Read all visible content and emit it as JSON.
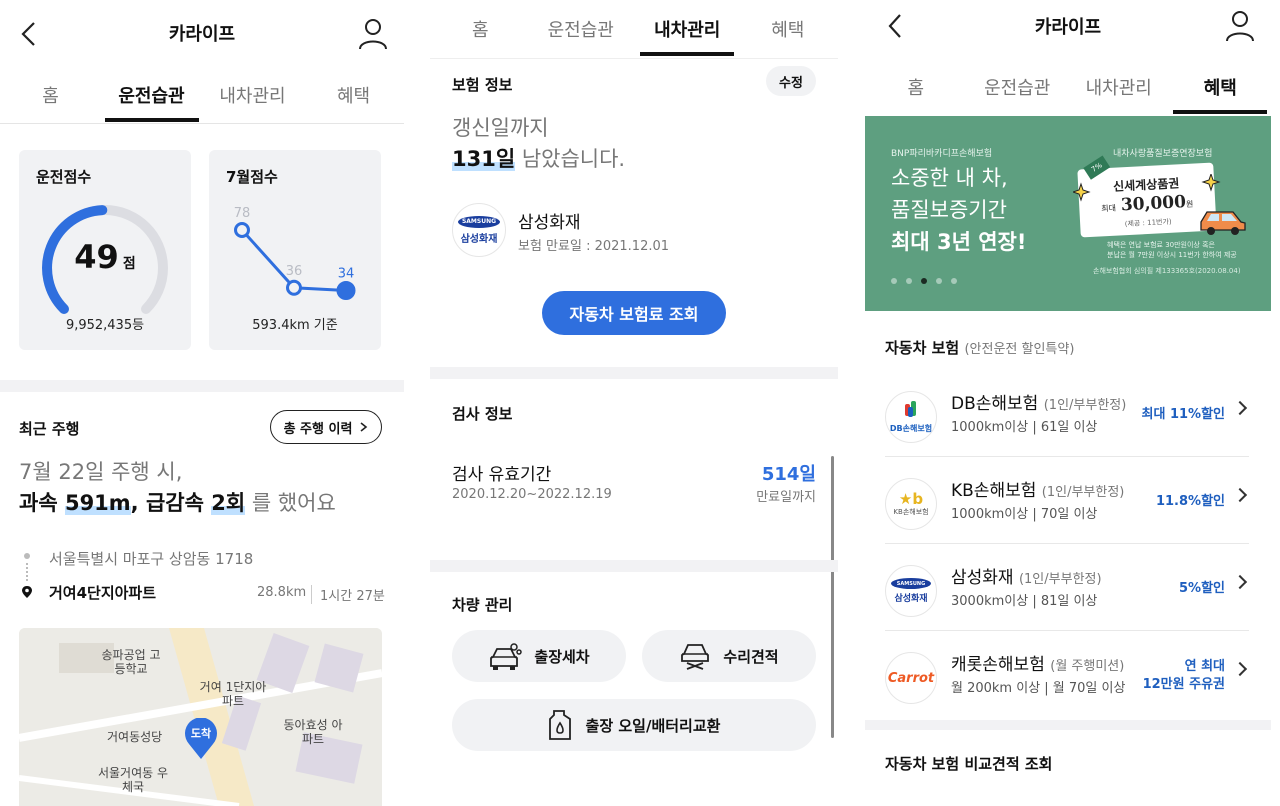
{
  "panel1": {
    "title": "카라이프",
    "tabs": [
      "홈",
      "운전습관",
      "내차관리",
      "혜택"
    ],
    "active_tab": 1,
    "score_card": {
      "label": "운전점수",
      "score": "49",
      "unit": "점",
      "rank": "9,952,435등",
      "gauge_fraction": 0.49
    },
    "month_card": {
      "label": "7월점수",
      "caption": "593.4km 기준",
      "chart_data": {
        "type": "line",
        "values": [
          78,
          36,
          34
        ],
        "ylim": [
          0,
          100
        ]
      },
      "point_labels": [
        "78",
        "36",
        "34"
      ]
    },
    "recent": {
      "title": "최근 주행",
      "history_button": "총 주행 이력",
      "line1": "7월 22일 주행 시,",
      "summary": {
        "p1": "과속 ",
        "p2": "591m",
        "p3": ", 급감속 ",
        "p4": "2회",
        "p5": " 를 했어요"
      },
      "start": "서울특별시 마포구 상암동 1718",
      "end": "거여4단지아파트",
      "distance": "28.8km",
      "duration": "1시간 27분"
    },
    "map": {
      "labels": [
        "송파공업 고등학교",
        "거여 1단지아파트",
        "동아효성 아파트",
        "거여동성당",
        "서울거여동 우체국"
      ],
      "marker": "도착"
    }
  },
  "panel2": {
    "tabs": [
      "홈",
      "운전습관",
      "내차관리",
      "혜택"
    ],
    "active_tab": 2,
    "insurance": {
      "title": "보험 정보",
      "edit": "수정",
      "line1": "갱신일까지",
      "days": "131일",
      "line2_rest": " 남았습니다.",
      "company": "삼성화재",
      "expiry": "보험 만료일 : 2021.12.01",
      "button": "자동차 보험료 조회"
    },
    "inspection": {
      "title": "검사 정보",
      "label": "검사 유효기간",
      "period": "2020.12.20~2022.12.19",
      "days": "514일",
      "days_caption": "만료일까지"
    },
    "vehicle": {
      "title": "차량 관리",
      "buttons": [
        "출장세차",
        "수리견적",
        "출장 오일/배터리교환"
      ]
    }
  },
  "panel3": {
    "title": "카라이프",
    "tabs": [
      "홈",
      "운전습관",
      "내차관리",
      "혜택"
    ],
    "active_tab": 3,
    "banner": {
      "company": "BNP파리바카디프손해보험",
      "headline": [
        "소중한 내 차,",
        "품질보증기간",
        "최대 3년 연장!"
      ],
      "coupon_title": "내차사랑품질보증연장보험",
      "coupon_name": "신세계상품권",
      "coupon_prefix": "최대",
      "coupon_amount": "30,000",
      "coupon_unit": "원",
      "coupon_note": "(제공 : 11번가)",
      "fine1": "혜택은 연납 보험료 30만원이상 혹은",
      "fine2": "분납은 월 7만원 이상시 11번가 한하여 제공",
      "fine3": "손해보험협회 심의필 제133365호(2020.08.04)",
      "dots": 5,
      "active_dot": 2,
      "bg": "#5e9f80"
    },
    "ins_section": {
      "title": "자동차 보험",
      "subtitle": "(안전운전 할인특약)"
    },
    "insurers": [
      {
        "name": "DB손해보험",
        "sub": "(1인/부부한정)",
        "cond": "1000km이상 | 61일 이상",
        "disc": [
          "최대 11%할인"
        ],
        "logo": "DB손해보험"
      },
      {
        "name": "KB손해보험",
        "sub": "(1인/부부한정)",
        "cond": "1000km이상 | 70일 이상",
        "disc": [
          "11.8%할인"
        ],
        "logo": "KB손해보험"
      },
      {
        "name": "삼성화재",
        "sub": "(1인/부부한정)",
        "cond": "3000km이상 | 81일 이상",
        "disc": [
          "5%할인"
        ],
        "logo": "삼성화재"
      },
      {
        "name": "캐롯손해보험",
        "sub": "(월 주행미션)",
        "cond": "월 200km 이상 | 월 70일 이상",
        "disc": [
          "연 최대",
          "12만원 주유권"
        ],
        "logo": "Carrot"
      }
    ],
    "compare_title": "자동차 보험 비교견적 조회"
  }
}
